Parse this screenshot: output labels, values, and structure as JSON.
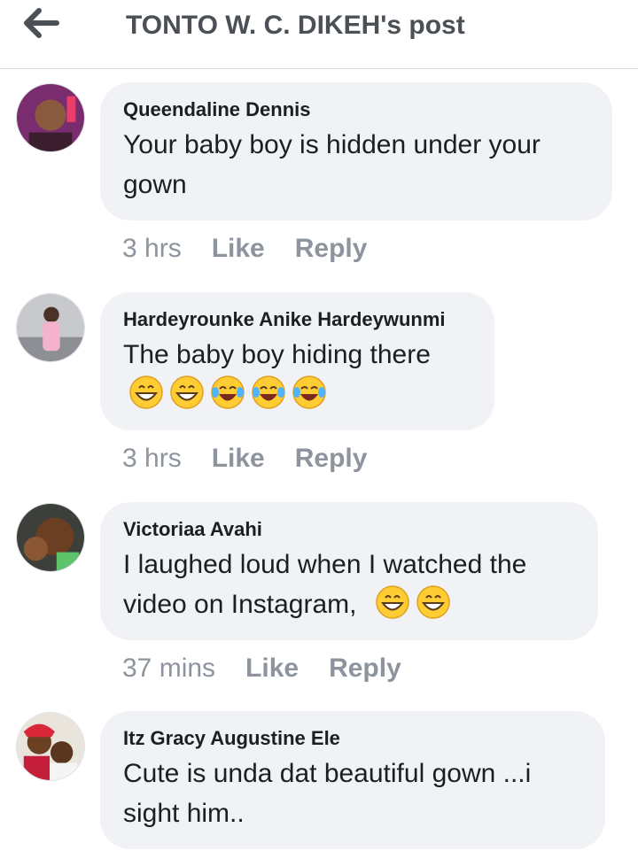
{
  "header": {
    "title": "TONTO W. C. DIKEH's post",
    "back_icon": "arrow-left-icon"
  },
  "comments": [
    {
      "author": "Queendaline Dennis",
      "text": "Your baby boy is hidden under your gown",
      "time": "3 hrs",
      "like": "Like",
      "reply": "Reply"
    },
    {
      "author": "Hardeyrounke Anike Hardeywunmi",
      "text": "The baby boy hiding there",
      "emojis": [
        "grinning-face",
        "grinning-face",
        "tears-of-joy",
        "tears-of-joy",
        "tears-of-joy"
      ],
      "time": "3 hrs",
      "like": "Like",
      "reply": "Reply"
    },
    {
      "author": "Victoriaa Avahi",
      "text": "I laughed loud when I watched the video on Instagram,",
      "emojis": [
        "grinning-face",
        "grinning-face"
      ],
      "time": "37 mins",
      "like": "Like",
      "reply": "Reply"
    },
    {
      "author": "Itz Gracy Augustine Ele",
      "text": "Cute is unda dat beautiful gown ...i sight him..",
      "time": "",
      "like": "",
      "reply": ""
    }
  ],
  "colors": {
    "bubble": "#f0f2f5",
    "meta": "#8d949e",
    "title": "#4b4f56",
    "emoji": "#ffcc33"
  }
}
